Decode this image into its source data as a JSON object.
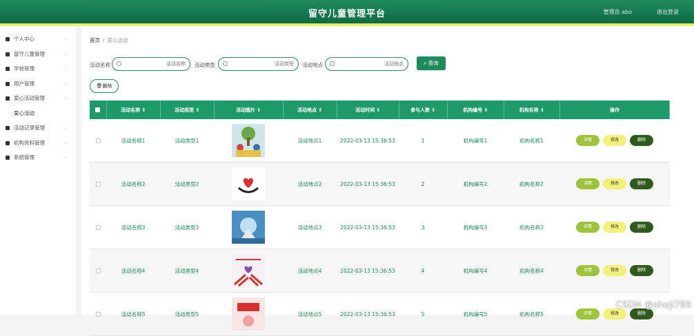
{
  "header": {
    "title": "留守儿童管理平台",
    "user": "管理员 abo",
    "logout": "退出登录"
  },
  "sidebar": {
    "items": [
      {
        "label": "个人中心",
        "icon": "user-icon",
        "arrow": true
      },
      {
        "label": "留守儿童管理",
        "icon": "grid-icon",
        "arrow": true
      },
      {
        "label": "学校管理",
        "icon": "briefcase-icon",
        "arrow": true
      },
      {
        "label": "用户管理",
        "icon": "pin-icon",
        "arrow": true
      },
      {
        "label": "爱心活动管理",
        "icon": "grid-icon",
        "arrow": true
      },
      {
        "label": "爱心活动",
        "icon": "",
        "arrow": false
      },
      {
        "label": "活动记录管理",
        "icon": "user-icon",
        "arrow": true
      },
      {
        "label": "机构资料管理",
        "icon": "doc-icon",
        "arrow": true
      },
      {
        "label": "系统管理",
        "icon": "grid-icon",
        "arrow": true
      }
    ]
  },
  "breadcrumb": {
    "home": "首页",
    "sep": "/",
    "current": "爱心活动"
  },
  "filters": {
    "name_label": "活动名称",
    "name_placeholder": "活动名称",
    "type_label": "活动类型",
    "type_placeholder": "活动类型",
    "place_label": "活动地点",
    "place_placeholder": "活动地点",
    "query_label": "查询"
  },
  "delete_label": "删除",
  "table": {
    "headers": [
      "活动名称",
      "活动类型",
      "活动图片",
      "活动地点",
      "活动时间",
      "参与人数",
      "机构编号",
      "机构名称",
      "操作"
    ],
    "rows": [
      {
        "name": "活动名称1",
        "type": "活动类型1",
        "place": "活动地点1",
        "time": "2022-03-13 15:36:53",
        "count": "1",
        "org_no": "机构编号1",
        "org_name": "机构名称1"
      },
      {
        "name": "活动名称2",
        "type": "活动类型2",
        "place": "活动地点2",
        "time": "2022-03-13 15:36:53",
        "count": "2",
        "org_no": "机构编号2",
        "org_name": "机构名称2"
      },
      {
        "name": "活动名称3",
        "type": "活动类型3",
        "place": "活动地点3",
        "time": "2022-03-13 15:36:53",
        "count": "3",
        "org_no": "机构编号3",
        "org_name": "机构名称3"
      },
      {
        "name": "活动名称4",
        "type": "活动类型4",
        "place": "活动地点4",
        "time": "2022-03-13 15:36:53",
        "count": "4",
        "org_no": "机构编号4",
        "org_name": "机构名称4"
      },
      {
        "name": "活动名称5",
        "type": "活动类型5",
        "place": "活动地点5",
        "time": "2022-03-13 15:36:53",
        "count": "5",
        "org_no": "机构编号5",
        "org_name": "机构名称5"
      }
    ],
    "ops": {
      "detail": "详情",
      "edit": "修改",
      "delete": "删除"
    }
  },
  "watermark": "CSDN @sheji789"
}
